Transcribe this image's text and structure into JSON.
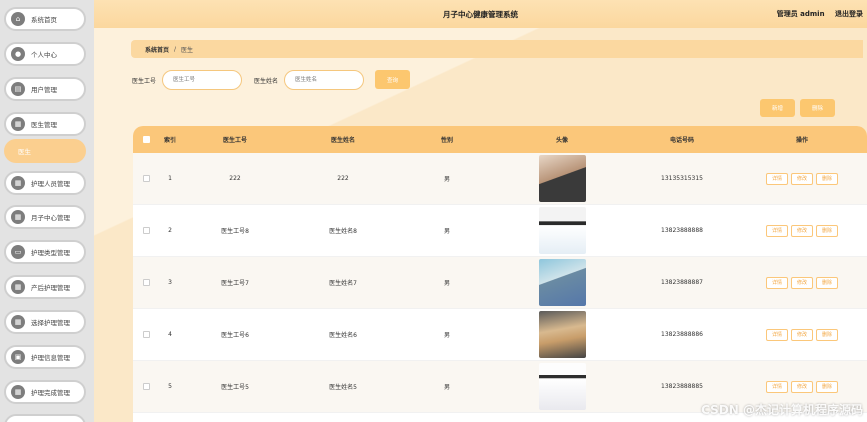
{
  "app": {
    "title": "月子中心健康管理系统",
    "user_label": "管理员 admin",
    "logout": "退出登录"
  },
  "sidebar": {
    "items": [
      {
        "label": "系统首页",
        "icon": "home-icon"
      },
      {
        "label": "个人中心",
        "icon": "user-icon"
      },
      {
        "label": "用户管理",
        "icon": "list-icon"
      },
      {
        "label": "医生管理",
        "icon": "grid-icon"
      },
      {
        "label": "医生",
        "icon": ""
      },
      {
        "label": "护理人员管理",
        "icon": "grid-icon"
      },
      {
        "label": "月子中心管理",
        "icon": "grid-icon"
      },
      {
        "label": "护理类型管理",
        "icon": "chat-icon"
      },
      {
        "label": "产后护理管理",
        "icon": "grid-icon"
      },
      {
        "label": "选择护理管理",
        "icon": "grid-icon"
      },
      {
        "label": "护理信息管理",
        "icon": "briefcase-icon"
      },
      {
        "label": "护理完成管理",
        "icon": "grid-icon"
      }
    ]
  },
  "breadcrumb": {
    "home": "系统首页",
    "sep": "/",
    "current": "医生"
  },
  "search": {
    "no_label": "医生工号",
    "no_placeholder": "医生工号",
    "name_label": "医生姓名",
    "name_placeholder": "医生姓名",
    "query_button": "查询"
  },
  "actions": {
    "add": "新增",
    "delete": "删除"
  },
  "table": {
    "headers": [
      "索引",
      "医生工号",
      "医生姓名",
      "性别",
      "头像",
      "电话号码",
      "操作"
    ],
    "op_labels": [
      "详情",
      "修改",
      "删除"
    ],
    "rows": [
      {
        "idx": "1",
        "no": "222",
        "name": "222",
        "sex": "男",
        "tel": "13135315315"
      },
      {
        "idx": "2",
        "no": "医生工号8",
        "name": "医生姓名8",
        "sex": "男",
        "tel": "13823888888"
      },
      {
        "idx": "3",
        "no": "医生工号7",
        "name": "医生姓名7",
        "sex": "男",
        "tel": "13823888887"
      },
      {
        "idx": "4",
        "no": "医生工号6",
        "name": "医生姓名6",
        "sex": "男",
        "tel": "13823888886"
      },
      {
        "idx": "5",
        "no": "医生工号5",
        "name": "医生姓名5",
        "sex": "男",
        "tel": "13823888885"
      }
    ]
  },
  "watermark": "CSDN @杰记计算机程序源码",
  "colors": {
    "accent": "#fbc77a",
    "header": "#fbd79e",
    "background": "#fdf1dc"
  }
}
